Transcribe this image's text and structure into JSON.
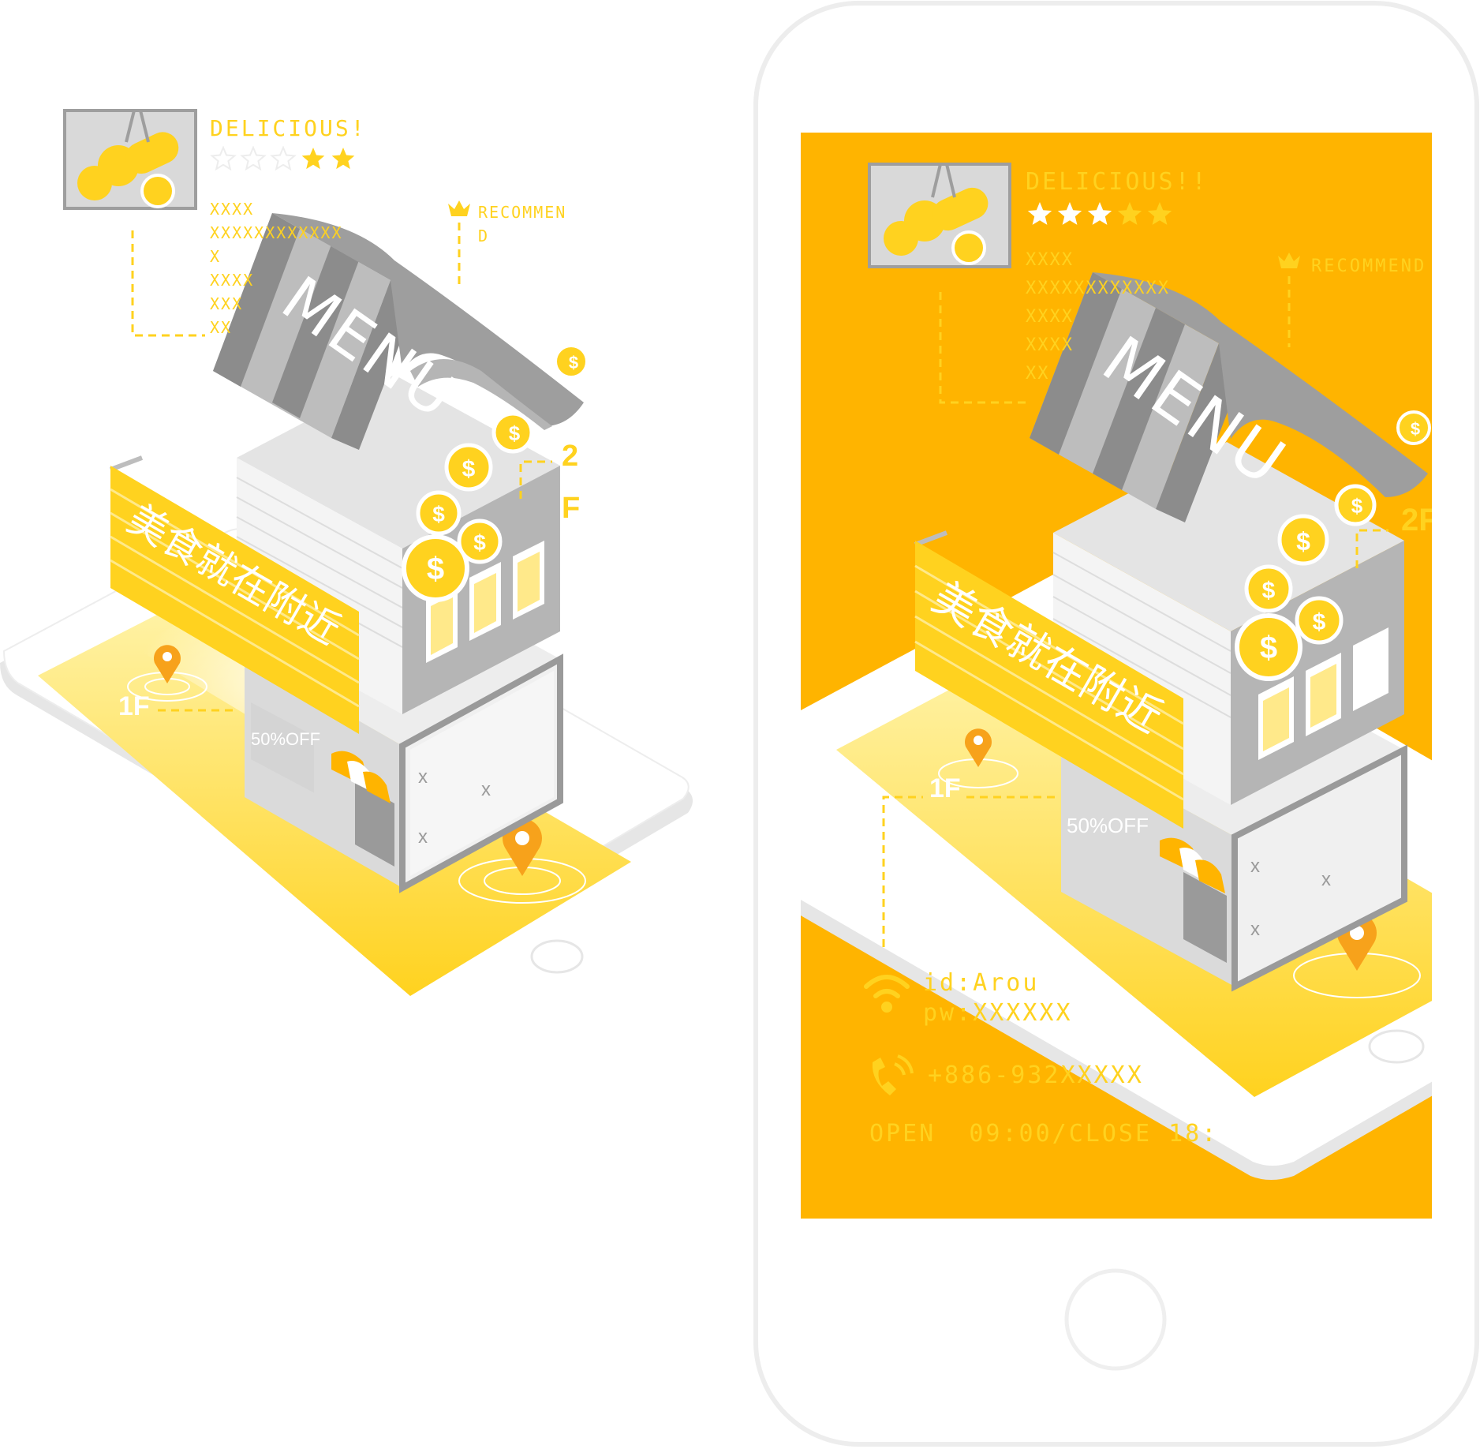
{
  "left": {
    "card": {
      "title": "DELICIOUS!",
      "rating_filled": 2,
      "rating_total": 5,
      "placeholder_lines": [
        "XXXX",
        "XXXXXXXXXXXX",
        "X",
        "XXXX",
        "XXX",
        "XX"
      ]
    },
    "recommend": {
      "line1": "RECOMMEN",
      "line2": "D"
    },
    "awning_text": "MENU",
    "banner_text": "美食就在附近",
    "floor_2_a": "2",
    "floor_2_b": "F",
    "floor_1": "1F",
    "sale_text": "50%OFF",
    "coin_symbol": "$"
  },
  "right": {
    "card": {
      "title": "DELICIOUS!!",
      "rating_filled": 5,
      "rating_total": 5,
      "placeholder_lines": [
        "XXXX",
        "XXXXXXXXXXXX",
        "XXXX",
        "XXXX",
        "XX"
      ]
    },
    "recommend": "RECOMMEND",
    "awning_text": "MENU",
    "banner_text": "美食就在附近",
    "floor_2": "2F",
    "floor_1": "1F",
    "sale_text": "50%OFF",
    "coin_symbol": "$",
    "wifi_id": "id:Arou",
    "wifi_pw": "pw:XXXXXX",
    "phone": "+886-932XXXXX",
    "hours": "OPEN  09:00/CLOSE 18:"
  },
  "colors": {
    "yellow": "#FFD21F",
    "orange": "#FFB400",
    "pin": "#F7A21B",
    "gray_dark": "#8C8C8C",
    "gray_mid": "#B5B5B5",
    "gray_light": "#D9D9D9"
  }
}
